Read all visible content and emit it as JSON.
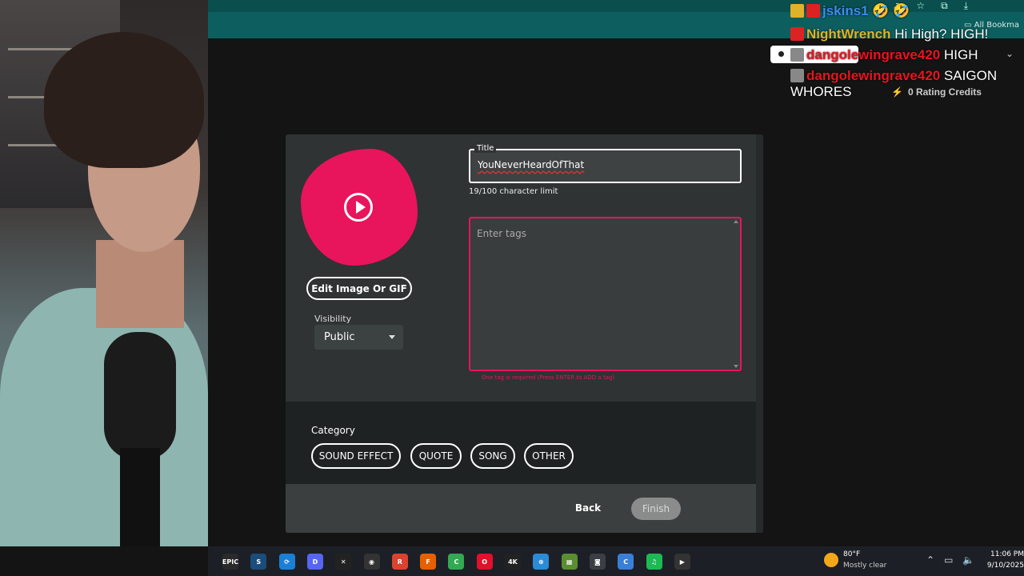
{
  "browser": {
    "bookmarks_label": "All Bookma"
  },
  "chat": {
    "messages": [
      {
        "user": "jskins1",
        "text": "🤣 🤣",
        "user_color": "#3a8ef0",
        "badge_color": "#e0b22a"
      },
      {
        "user": "NightWrench",
        "text": "Hi High? HIGH!",
        "user_color": "#e0b22a",
        "badge_color": "#d22"
      },
      {
        "user": "dangolewingrave420",
        "text": "HIGH",
        "user_color": "#e8141e",
        "badge_color": "#888"
      },
      {
        "user": "dangolewingrave420",
        "text": "SAIGON",
        "user_color": "#e8141e",
        "badge_color": "#888"
      }
    ],
    "continuation": "WHORES",
    "credits": "0 Rating Credits"
  },
  "dialog": {
    "edit_image_label": "Edit Image Or GIF",
    "visibility": {
      "label": "Visibility",
      "value": "Public"
    },
    "title": {
      "label": "Title",
      "value": "YouNeverHeardOfThat",
      "limit_text": "19/100 character limit"
    },
    "tags": {
      "placeholder": "Enter tags",
      "error": "One tag is required (Press ENTER to ADD a tag)"
    },
    "category": {
      "label": "Category",
      "options": [
        "SOUND EFFECT",
        "QUOTE",
        "SONG",
        "OTHER"
      ]
    },
    "back_label": "Back",
    "finish_label": "Finish"
  },
  "taskbar": {
    "apps": [
      {
        "name": "epic-games",
        "glyph": "EPIC",
        "color": "#2a2a2a"
      },
      {
        "name": "steam",
        "glyph": "S",
        "color": "#1b4c7a"
      },
      {
        "name": "sync",
        "glyph": "⟳",
        "color": "#1a7fd6"
      },
      {
        "name": "discord",
        "glyph": "D",
        "color": "#5865f2"
      },
      {
        "name": "capcut",
        "glyph": "✕",
        "color": "#222"
      },
      {
        "name": "obs",
        "glyph": "◉",
        "color": "#333"
      },
      {
        "name": "app-red",
        "glyph": "R",
        "color": "#d9432f"
      },
      {
        "name": "firefox",
        "glyph": "F",
        "color": "#e66000"
      },
      {
        "name": "chrome",
        "glyph": "C",
        "color": "#34a853"
      },
      {
        "name": "opera",
        "glyph": "O",
        "color": "#e0112b"
      },
      {
        "name": "4k-video",
        "glyph": "4K",
        "color": "#222"
      },
      {
        "name": "globe",
        "glyph": "⊕",
        "color": "#2b8bd6"
      },
      {
        "name": "minecraft",
        "glyph": "▦",
        "color": "#5b8d32"
      },
      {
        "name": "camera",
        "glyph": "◙",
        "color": "#3a3f46"
      },
      {
        "name": "ccleaner",
        "glyph": "C",
        "color": "#3a7fd6"
      },
      {
        "name": "spotify",
        "glyph": "♫",
        "color": "#1db954"
      },
      {
        "name": "media-player",
        "glyph": "▶",
        "color": "#333"
      }
    ],
    "weather": {
      "temp": "80°F",
      "desc": "Mostly clear"
    },
    "clock": {
      "time": "11:06 PM",
      "date": "9/10/2025"
    }
  }
}
